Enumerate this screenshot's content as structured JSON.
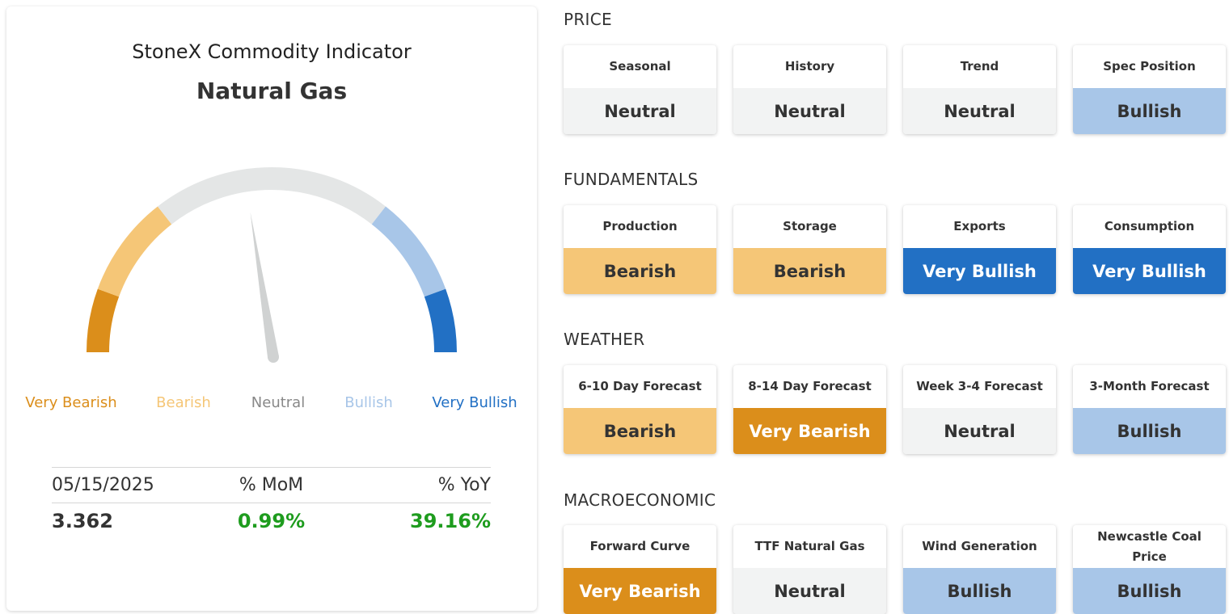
{
  "indicator": {
    "title": "StoneX Commodity Indicator",
    "commodity": "Natural Gas",
    "gauge_level": 0.45,
    "legend": [
      {
        "label": "Very Bearish",
        "color": "#db8e1b"
      },
      {
        "label": "Bearish",
        "color": "#f5c677"
      },
      {
        "label": "Neutral",
        "color": "#888888"
      },
      {
        "label": "Bullish",
        "color": "#a8c6e8"
      },
      {
        "label": "Very Bullish",
        "color": "#2270c4"
      }
    ],
    "stats": {
      "date": "05/15/2025",
      "mom_label": "% MoM",
      "yoy_label": "% YoY",
      "price": "3.362",
      "mom_value": "0.99%",
      "yoy_value": "39.16%"
    }
  },
  "sections": [
    {
      "heading": "PRICE",
      "tiles": [
        {
          "label": "Seasonal",
          "value": "Neutral",
          "sentiment": "neutral"
        },
        {
          "label": "History",
          "value": "Neutral",
          "sentiment": "neutral"
        },
        {
          "label": "Trend",
          "value": "Neutral",
          "sentiment": "neutral"
        },
        {
          "label": "Spec Position",
          "value": "Bullish",
          "sentiment": "bullish"
        }
      ]
    },
    {
      "heading": "FUNDAMENTALS",
      "tiles": [
        {
          "label": "Production",
          "value": "Bearish",
          "sentiment": "bearish"
        },
        {
          "label": "Storage",
          "value": "Bearish",
          "sentiment": "bearish"
        },
        {
          "label": "Exports",
          "value": "Very Bullish",
          "sentiment": "vbullish"
        },
        {
          "label": "Consumption",
          "value": "Very Bullish",
          "sentiment": "vbullish"
        }
      ]
    },
    {
      "heading": "WEATHER",
      "tiles": [
        {
          "label": "6-10 Day Forecast",
          "value": "Bearish",
          "sentiment": "bearish"
        },
        {
          "label": "8-14 Day Forecast",
          "value": "Very Bearish",
          "sentiment": "vbearish"
        },
        {
          "label": "Week 3-4 Forecast",
          "value": "Neutral",
          "sentiment": "neutral"
        },
        {
          "label": "3-Month Forecast",
          "value": "Bullish",
          "sentiment": "bullish"
        }
      ]
    },
    {
      "heading": "MACROECONOMIC",
      "tiles": [
        {
          "label": "Forward Curve",
          "value": "Very Bearish",
          "sentiment": "vbearish"
        },
        {
          "label": "TTF Natural Gas",
          "value": "Neutral",
          "sentiment": "neutral"
        },
        {
          "label": "Wind Generation",
          "value": "Bullish",
          "sentiment": "bullish"
        },
        {
          "label": "Newcastle Coal Price",
          "value": "Bullish",
          "sentiment": "bullish"
        }
      ]
    }
  ]
}
